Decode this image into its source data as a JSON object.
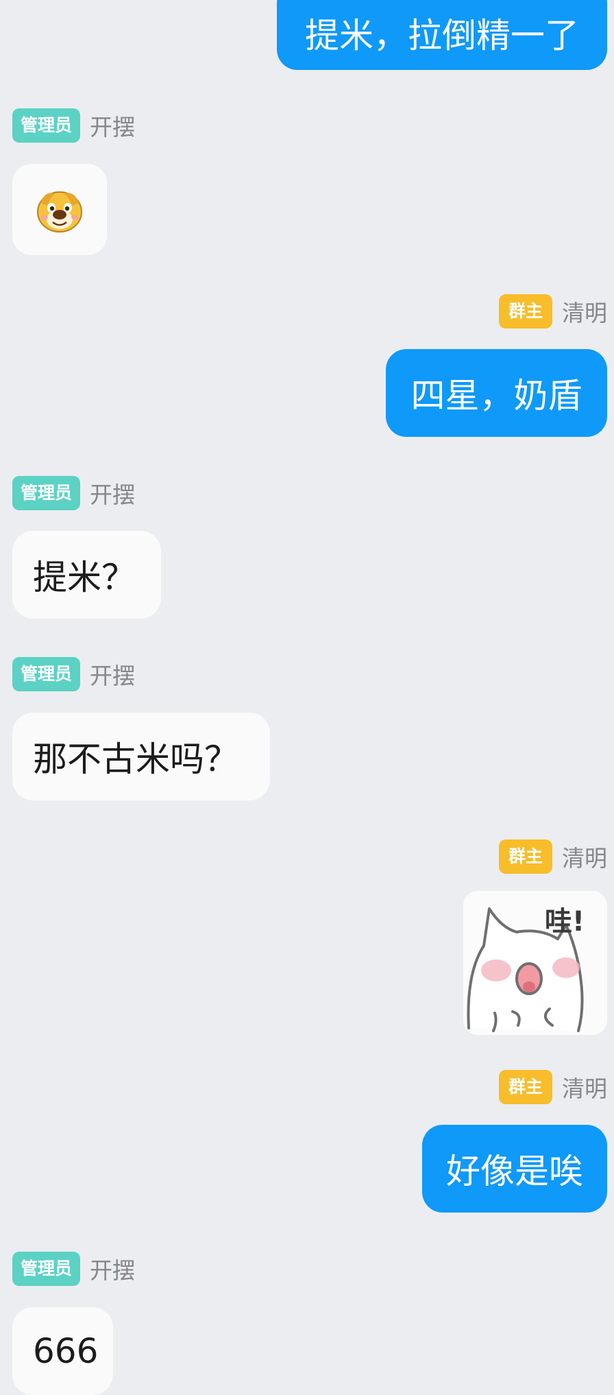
{
  "messages": [
    {
      "type": "text",
      "side": "out",
      "text": "提米，拉倒精一了"
    },
    {
      "type": "sticker",
      "side": "in",
      "role": "管理员",
      "user": "开摆",
      "sticker": "dog-face-sticker"
    },
    {
      "type": "text",
      "side": "out",
      "role": "群主",
      "user": "清明",
      "text": "四星，奶盾"
    },
    {
      "type": "text",
      "side": "in",
      "role": "管理员",
      "user": "开摆",
      "text": "提米？"
    },
    {
      "type": "text",
      "side": "in",
      "role": "管理员",
      "user": "开摆",
      "text": "那不古米吗？"
    },
    {
      "type": "sticker",
      "side": "out",
      "role": "群主",
      "user": "清明",
      "sticker": "cat-wa-sticker",
      "sticker_text": "哇!"
    },
    {
      "type": "text",
      "side": "out",
      "role": "群主",
      "user": "清明",
      "text": "好像是唉"
    },
    {
      "type": "text",
      "side": "in",
      "role": "管理员",
      "user": "开摆",
      "text": "666"
    }
  ],
  "colors": {
    "background": "#ecedf1",
    "outgoing_bubble": "#0f99f8",
    "incoming_bubble": "#fafafa",
    "admin_badge": "#5bd2c4",
    "owner_badge": "#f7bd2a",
    "username": "#878787"
  }
}
